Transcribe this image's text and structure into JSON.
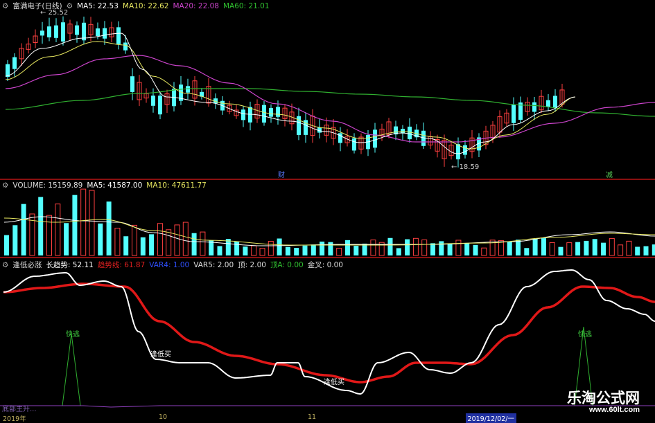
{
  "price_pane": {
    "title": "富满电子(日线)",
    "ma5": "MA5: 22.53",
    "ma10": "MA10: 22.62",
    "ma20": "MA20: 22.08",
    "ma60": "MA60: 21.01",
    "high_label": "25.52",
    "low_label": "18.59",
    "flag_cai": "财",
    "flag_jian": "减"
  },
  "volume_pane": {
    "volume": "VOLUME: 15159.89",
    "ma5": "MA5: 41587.00",
    "ma10": "MA10: 47611.77"
  },
  "indicator_pane": {
    "name": "逢低必涨",
    "long_trend": "长趋势: 52.11",
    "trend_line": "趋势线: 61.87",
    "var4": "VAR4: 1.00",
    "var5": "VAR5: 2.00",
    "top": "顶: 2.00",
    "top_a": "顶A: 0.00",
    "golden_cross": "金叉: 0.00",
    "marker_quick_sell": "快逃",
    "marker_buy": "逢低买",
    "bottom_text": "底部主升..."
  },
  "date_axis": {
    "start": "2019年",
    "tick_10": "10",
    "tick_11": "11",
    "current_date": "2019/12/02/一"
  },
  "watermark": {
    "name": "乐淘公式网",
    "url": "www.60lt.com"
  },
  "colors": {
    "up": "#ff4040",
    "down": "#54ffff",
    "ma5": "#ffffff",
    "ma10": "#e8e860",
    "ma20": "#cc44cc",
    "ma60": "#30b030",
    "trend": "#e01818"
  }
}
